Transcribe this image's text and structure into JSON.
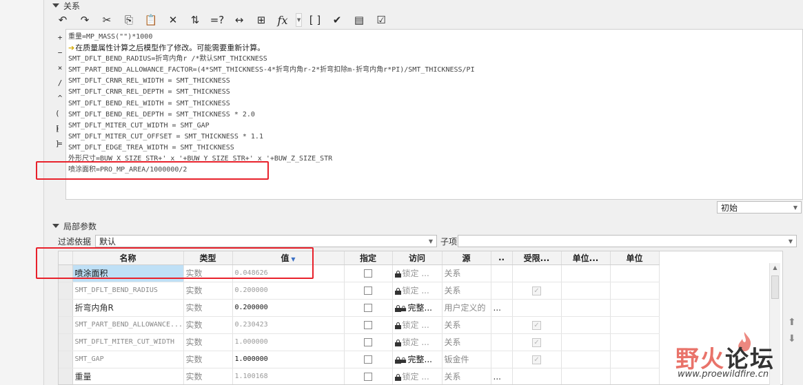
{
  "relations_panel": {
    "section_title": "关系",
    "toolbar": [
      {
        "icon": "undo-icon",
        "glyph": "↶"
      },
      {
        "icon": "redo-icon",
        "glyph": "↷"
      },
      {
        "icon": "cut-icon",
        "glyph": "✂"
      },
      {
        "icon": "copy-icon",
        "glyph": "⎘"
      },
      {
        "icon": "paste-icon",
        "glyph": "📋"
      },
      {
        "icon": "delete-icon",
        "glyph": "✕"
      },
      {
        "icon": "sort-param-icon",
        "glyph": "⇅"
      },
      {
        "icon": "evaluate-icon",
        "glyph": "=?"
      },
      {
        "icon": "dimension-icon",
        "glyph": "↔"
      },
      {
        "icon": "unit-sensitivity-icon",
        "glyph": "⊞"
      },
      {
        "icon": "function-icon",
        "glyph": "fx"
      },
      {
        "icon": "brackets-icon",
        "glyph": "[ ]"
      },
      {
        "icon": "verify-icon",
        "glyph": "✔"
      },
      {
        "icon": "local-params-icon",
        "glyph": "▤"
      },
      {
        "icon": "checklist-icon",
        "glyph": "☑"
      }
    ],
    "operators": [
      "+",
      "−",
      "×",
      "/",
      "^",
      "( )",
      "[ ]",
      "="
    ],
    "lines": [
      "重量=MP_MASS(\"\")*1000",
      "在质量属性计算之后模型作了修改。可能需要重新计算。",
      "SMT_DFLT_BEND_RADIUS=折弯内角r /*默认SMT_THICKNESS",
      "SMT_PART_BEND_ALLOWANCE_FACTOR=(4*SMT_THICKNESS-4*折弯内角r-2*折弯扣除m-折弯内角r*PI)/SMT_THICKNESS/PI",
      "SMT_DFLT_CRNR_REL_WIDTH = SMT_THICKNESS",
      "SMT_DFLT_CRNR_REL_DEPTH = SMT_THICKNESS",
      "SMT_DFLT_BEND_REL_WIDTH = SMT_THICKNESS",
      "SMT_DFLT_BEND_REL_DEPTH = SMT_THICKNESS * 2.0",
      "SMT_DFLT_MITER_CUT_WIDTH = SMT_GAP",
      "SMT_DFLT_MITER_CUT_OFFSET = SMT_THICKNESS * 1.1",
      "SMT_DFLT_EDGE_TREA_WIDTH = SMT_THICKNESS",
      "外形尺寸=BUW_X_SIZE_STR+' x '+BUW_Y_SIZE_STR+' x '+BUW_Z_SIZE_STR",
      "喷涂面积=PRO_MP_AREA/1000000/2"
    ],
    "warning_line_index": 1,
    "state_select": "初始"
  },
  "local_params": {
    "section_title": "局部参数",
    "filter_label": "过滤依据",
    "filter_value": "默认",
    "child_label": "子项",
    "child_value": "",
    "columns": [
      "名称",
      "类型",
      "值",
      "指定",
      "访问",
      "源",
      "..",
      "受限...",
      "单位...",
      "单位"
    ],
    "rows": [
      {
        "name": "喷涂面积",
        "type": "实数",
        "value": "0.048626",
        "access": "锁定 ...",
        "source": "关系",
        "extra": "",
        "restricted": false,
        "selected": true,
        "dark": false,
        "locked_style": "locked"
      },
      {
        "name": "SMT_DFLT_BEND_RADIUS",
        "type": "实数",
        "value": "0.200000",
        "access": "锁定 ...",
        "source": "关系",
        "extra": "",
        "restricted": true,
        "selected": false,
        "dark": false,
        "locked_style": "locked"
      },
      {
        "name": "折弯内角R",
        "type": "实数",
        "value": "0.200000",
        "access": "完整...",
        "source": "用户定义的",
        "extra": "...",
        "restricted": false,
        "selected": false,
        "dark": true,
        "locked_style": "full"
      },
      {
        "name": "SMT_PART_BEND_ALLOWANCE...",
        "type": "实数",
        "value": "0.230423",
        "access": "锁定 ...",
        "source": "关系",
        "extra": "",
        "restricted": true,
        "selected": false,
        "dark": false,
        "locked_style": "locked"
      },
      {
        "name": "SMT_DFLT_MITER_CUT_WIDTH",
        "type": "实数",
        "value": "1.000000",
        "access": "锁定 ...",
        "source": "关系",
        "extra": "",
        "restricted": true,
        "selected": false,
        "dark": false,
        "locked_style": "locked"
      },
      {
        "name": "SMT_GAP",
        "type": "实数",
        "value": "1.000000",
        "access": "完整...",
        "source": "钣金件",
        "extra": "",
        "restricted": true,
        "selected": false,
        "dark": true,
        "locked_style": "full"
      },
      {
        "name": "重量",
        "type": "实数",
        "value": "1.100168",
        "access": "锁定 ...",
        "source": "关系",
        "extra": "...",
        "restricted": false,
        "selected": false,
        "dark": false,
        "locked_style": "locked"
      }
    ]
  },
  "watermark": {
    "text_a": "野火",
    "text_b": "论坛",
    "url": "www.proewildfire.cn"
  },
  "colors": {
    "highlight_red": "#e8202a",
    "selection_blue": "#bfe0f6"
  }
}
